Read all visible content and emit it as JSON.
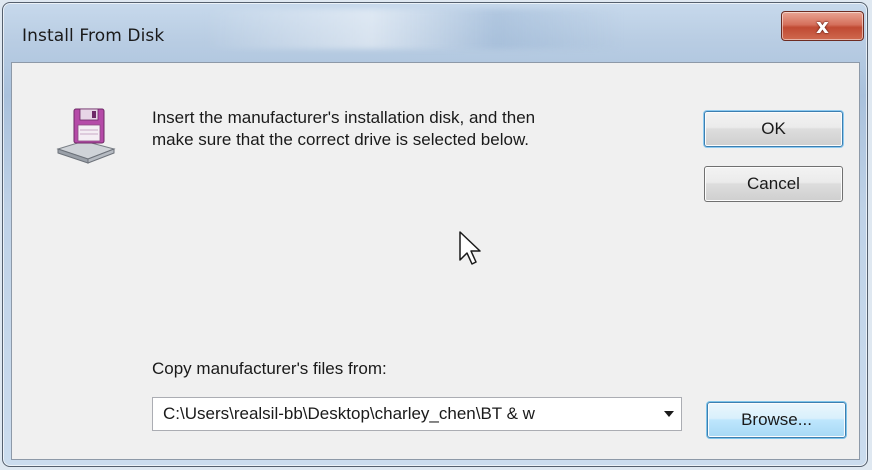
{
  "window": {
    "title": "Install From Disk",
    "close_label": "x"
  },
  "dialog": {
    "message_line1": "Insert the manufacturer's installation disk, and then",
    "message_line2": "make sure that the correct drive is selected below.",
    "ok_label": "OK",
    "cancel_label": "Cancel",
    "copy_label": "Copy manufacturer's files from:",
    "path_value": "C:\\Users\\realsil-bb\\Desktop\\charley_chen\\BT & w",
    "browse_label": "Browse...",
    "icon": "floppy-disk-install-icon"
  },
  "colors": {
    "close_button": "#c95a42",
    "focus_border": "#3c7fb1",
    "client_bg": "#f0f0f0"
  }
}
